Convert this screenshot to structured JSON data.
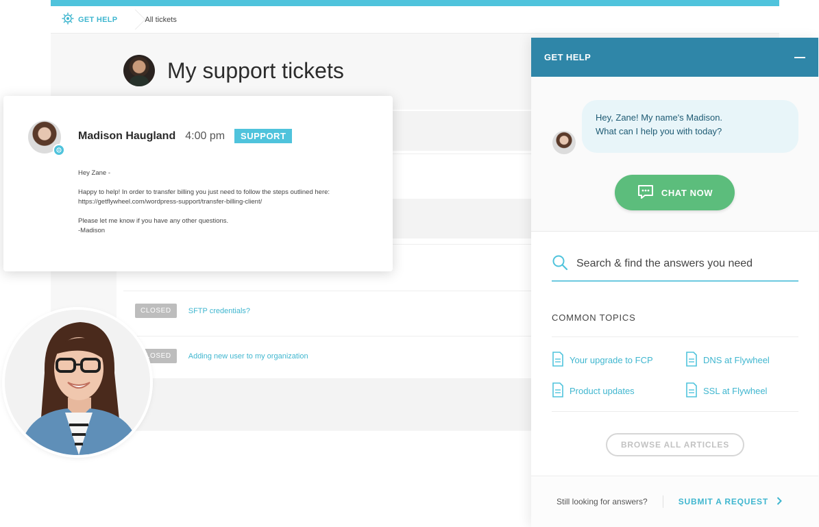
{
  "breadcrumb": {
    "section_label": "GET HELP",
    "current_label": "All tickets"
  },
  "page": {
    "title": "My support tickets"
  },
  "message": {
    "author": "Madison Haugland",
    "time": "4:00 pm",
    "badge": "SUPPORT",
    "greeting": "Hey Zane -",
    "line1": "Happy to help! In order to transfer billing you just need to follow the steps outlined here:",
    "link": "https://getflywheel.com/wordpress-support/transfer-billing-client/",
    "line2": "Please let me know if you have any other questions.",
    "signoff": "-Madison"
  },
  "tickets": [
    {
      "status": "CLOSED",
      "title": "SFTP credentials?"
    },
    {
      "status": "CLOSED",
      "title": "Adding new user to my organization"
    }
  ],
  "help_panel": {
    "title": "GET HELP",
    "chat_line1": "Hey, Zane! My name's Madison.",
    "chat_line2": "What can I help you with today?",
    "chat_button": "CHAT NOW",
    "search_placeholder": "Search & find the answers you need",
    "topics_title": "COMMON TOPICS",
    "topics": [
      "Your upgrade to FCP",
      "DNS at Flywheel",
      "Product updates",
      "SSL at Flywheel"
    ],
    "browse_button": "BROWSE ALL ARTICLES",
    "footer_text": "Still looking for answers?",
    "submit_link": "SUBMIT A REQUEST"
  },
  "colors": {
    "accent": "#4fc3dc",
    "header": "#2f86a8",
    "chat_green": "#5cbd7c",
    "closed_grey": "#bdbdbd"
  }
}
